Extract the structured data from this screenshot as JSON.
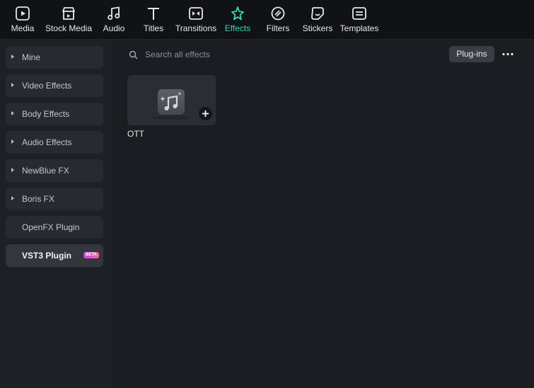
{
  "toolbar": {
    "tabs": [
      {
        "label": "Media",
        "icon": "media-icon"
      },
      {
        "label": "Stock Media",
        "icon": "stock-media-icon"
      },
      {
        "label": "Audio",
        "icon": "music-note-icon"
      },
      {
        "label": "Titles",
        "icon": "text-t-icon"
      },
      {
        "label": "Transitions",
        "icon": "transitions-icon"
      },
      {
        "label": "Effects",
        "icon": "effects-sparkle-icon",
        "active": true
      },
      {
        "label": "Filters",
        "icon": "filters-icon"
      },
      {
        "label": "Stickers",
        "icon": "stickers-icon"
      },
      {
        "label": "Templates",
        "icon": "templates-icon"
      }
    ],
    "active_color": "#3fd6b4"
  },
  "sidebar": {
    "items": [
      {
        "label": "Mine",
        "expandable": true
      },
      {
        "label": "Video Effects",
        "expandable": true
      },
      {
        "label": "Body Effects",
        "expandable": true
      },
      {
        "label": "Audio Effects",
        "expandable": true
      },
      {
        "label": "NewBlue FX",
        "expandable": true
      },
      {
        "label": "Boris FX",
        "expandable": true
      },
      {
        "label": "OpenFX Plugin",
        "expandable": false
      },
      {
        "label": "VST3 Plugin",
        "expandable": false,
        "selected": true,
        "badge": "BETA"
      }
    ]
  },
  "main": {
    "search_placeholder": "Search all effects",
    "plugins_button": "Plug-ins",
    "effects": [
      {
        "title": "OTT",
        "icon": "music-note-icon"
      }
    ]
  }
}
